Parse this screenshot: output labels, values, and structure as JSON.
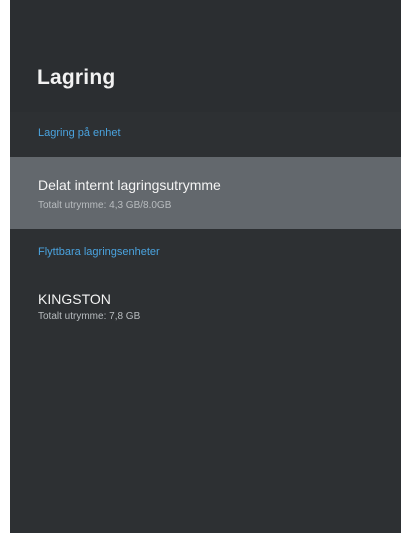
{
  "header": {
    "title": "Lagring"
  },
  "sections": [
    {
      "label": "Lagring på enhet",
      "items": [
        {
          "title": "Delat internt lagringsutrymme",
          "subtitle": "Totalt utrymme: 4,3 GB/8.0GB",
          "selected": true
        }
      ]
    },
    {
      "label": "Flyttbara lagringsenheter",
      "items": [
        {
          "title": "KINGSTON",
          "subtitle": "Totalt utrymme: 7,8 GB",
          "selected": false
        }
      ]
    }
  ],
  "colors": {
    "background": "#2d3033",
    "accent": "#4aa3df",
    "selected_item": "#63686d"
  }
}
